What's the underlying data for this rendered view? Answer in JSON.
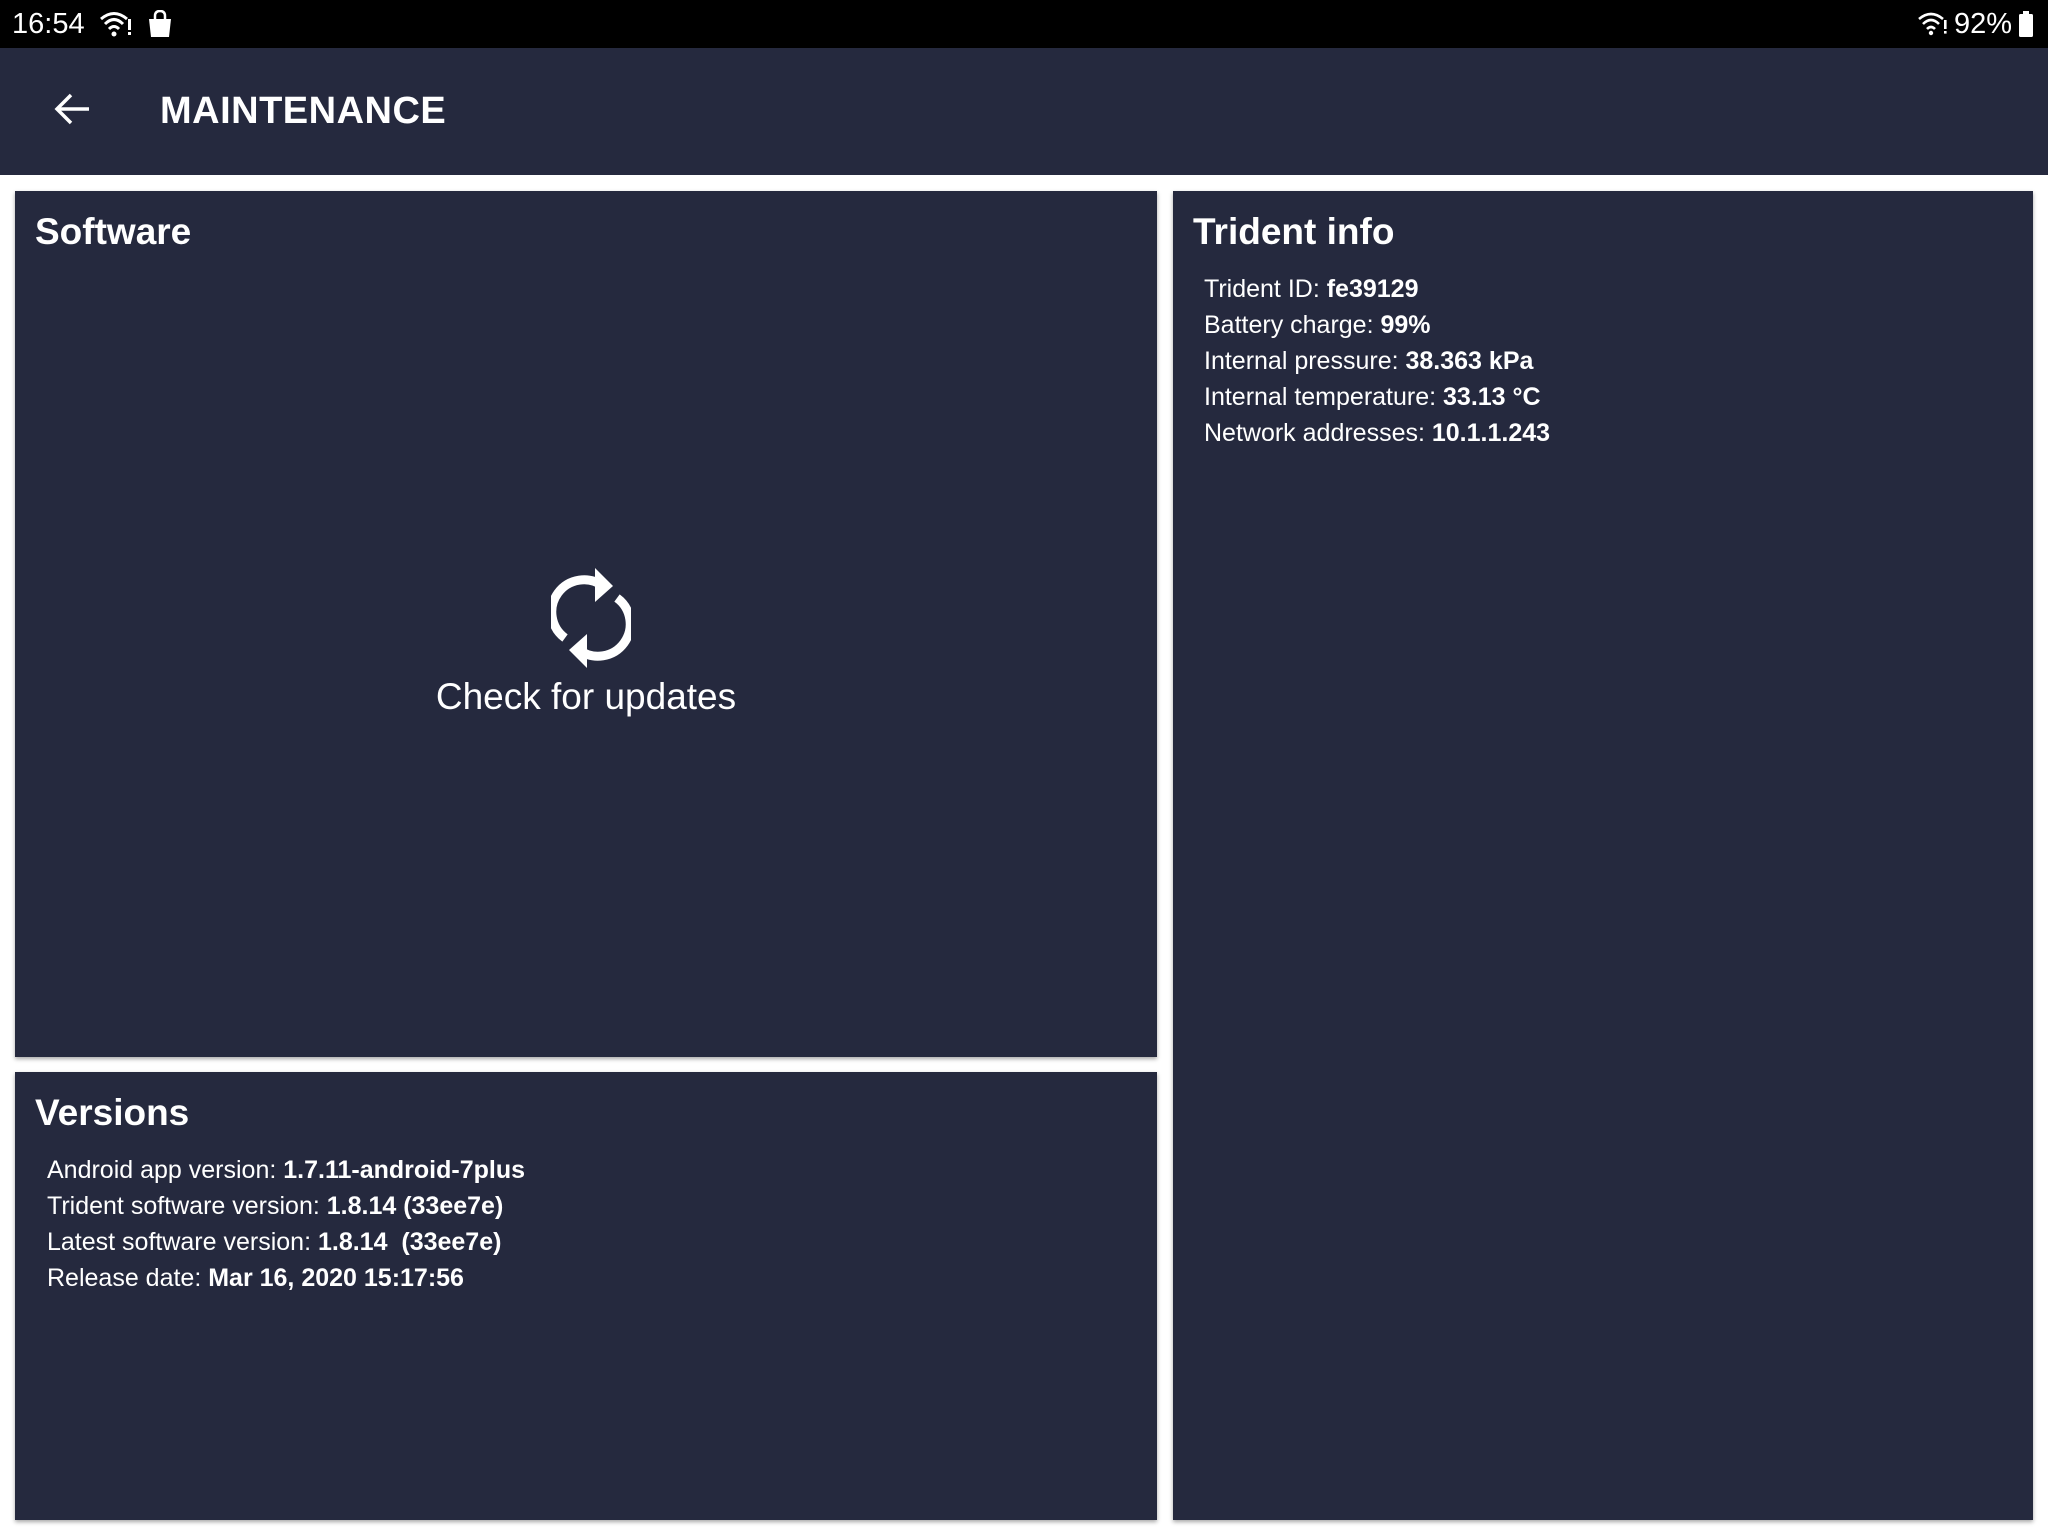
{
  "status_bar": {
    "time": "16:54",
    "battery": "92%",
    "left_icons": [
      "wifi-icon",
      "shopping-bag-icon"
    ],
    "right_icons": [
      "wifi-icon",
      "battery-icon"
    ]
  },
  "app_bar": {
    "title": "MAINTENANCE",
    "back_icon": "arrow-left-icon"
  },
  "software": {
    "title": "Software",
    "update_icon": "sync-icon",
    "update_label": "Check for updates"
  },
  "versions": {
    "title": "Versions",
    "items": [
      {
        "label": "Android app version: ",
        "value": "1.7.11-android-7plus"
      },
      {
        "label": "Trident software version: ",
        "value": "1.8.14 (33ee7e)"
      },
      {
        "label": "Latest software version: ",
        "value": "1.8.14  (33ee7e)"
      },
      {
        "label": "Release date: ",
        "value": "Mar 16, 2020 15:17:56"
      }
    ]
  },
  "trident_info": {
    "title": "Trident info",
    "items": [
      {
        "label": "Trident ID: ",
        "value": "fe39129"
      },
      {
        "label": "Battery charge: ",
        "value": "99%"
      },
      {
        "label": "Internal pressure: ",
        "value": "38.363 kPa"
      },
      {
        "label": "Internal temperature: ",
        "value": "33.13 °C"
      },
      {
        "label": "Network addresses: ",
        "value": "10.1.1.243"
      }
    ]
  },
  "colors": {
    "panel_bg": "#25293e",
    "status_bar_bg": "#000000",
    "text": "#ffffff"
  }
}
